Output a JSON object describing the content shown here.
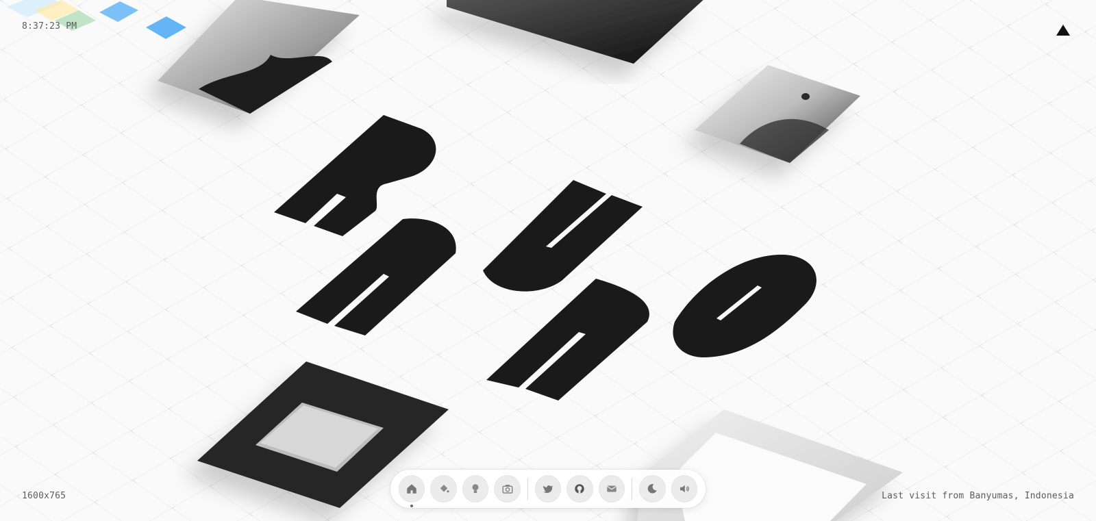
{
  "hud": {
    "clock": "8:37:23 PM",
    "resolution": "1600x765",
    "last_visit": "Last visit from Banyumas, Indonesia"
  },
  "colors": {
    "background": "#fafafa",
    "ink": "#1a1a1a",
    "tile_blue": "#64b5f6",
    "tile_yellow": "#fde9a8",
    "tile_green": "#a8d8b0"
  },
  "hero_letters": [
    "R",
    "U",
    "N",
    "O",
    "A"
  ],
  "dock": {
    "items": [
      {
        "icon": "home-icon",
        "active": true
      },
      {
        "icon": "paint-bucket-icon",
        "active": false
      },
      {
        "icon": "lightbulb-icon",
        "active": false
      },
      {
        "icon": "camera-icon",
        "active": false
      },
      {
        "icon": "twitter-icon",
        "active": false
      },
      {
        "icon": "github-icon",
        "active": false
      },
      {
        "icon": "mail-icon",
        "active": false
      },
      {
        "icon": "moon-icon",
        "active": false
      },
      {
        "icon": "speaker-icon",
        "active": false
      }
    ]
  }
}
